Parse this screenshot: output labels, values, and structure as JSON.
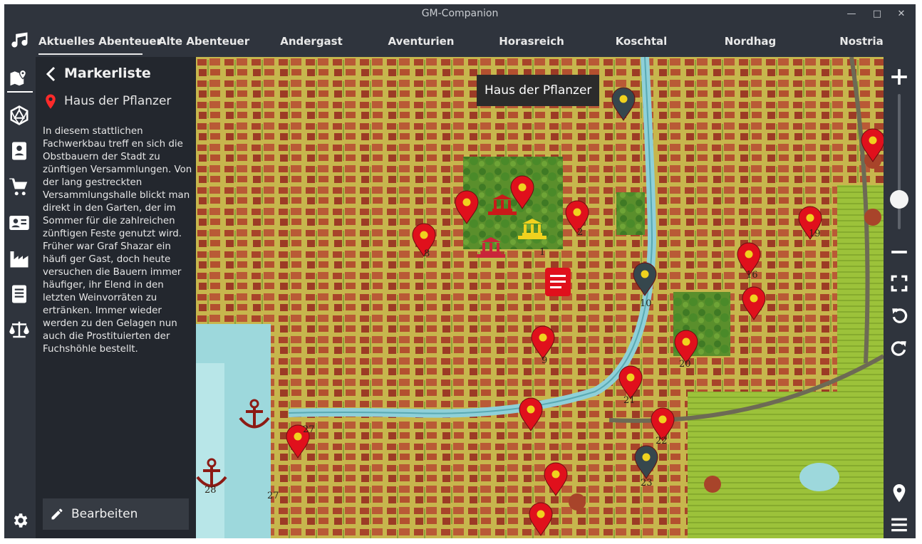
{
  "window": {
    "title": "GM-Companion"
  },
  "tabs": [
    {
      "label": "Aktuelles Abenteuer",
      "active": true
    },
    {
      "label": "Alte Abenteuer",
      "active": false
    },
    {
      "label": "Andergast",
      "active": false
    },
    {
      "label": "Aventurien",
      "active": false
    },
    {
      "label": "Horasreich",
      "active": false
    },
    {
      "label": "Koschtal",
      "active": false
    },
    {
      "label": "Nordhag",
      "active": false
    },
    {
      "label": "Nostria",
      "active": false
    }
  ],
  "left_tools": [
    "music-icon",
    "map-icon",
    "dice-icon",
    "character-icon",
    "shop-icon",
    "contact-card-icon",
    "factory-icon",
    "book-icon",
    "balance-scale-icon",
    "settings-icon"
  ],
  "marker_panel": {
    "title": "Markerliste",
    "marker_name": "Haus der Pflanzer",
    "description": "In diesem stattlichen Fachwerkbau treff en sich die Obstbauern der Stadt zu zünftigen Versammlungen. Von der lang gestreckten Versammlungshalle blickt man direkt in den Garten, der im Sommer für die zahlreichen zünftigen Feste genutzt wird. Früher war Graf Shazar ein häufi ger Gast, doch heute versuchen die Bauern immer häufiger, ihr Elend in den letzten Weinvorräten zu ertränken. Immer wieder werden zu den Gelagen nun auch die Prostituierten der Fuchshöhle bestellt.",
    "edit_label": "Bearbeiten"
  },
  "map": {
    "tooltip": "Haus der Pflanzer",
    "labels": [
      "8",
      "2",
      "19",
      "16",
      "10",
      "9",
      "20",
      "21",
      "22",
      "23",
      "27",
      "27",
      "28",
      "1"
    ],
    "zoom_level": 0.25
  },
  "map_controls": [
    "zoom-in-icon",
    "zoom-out-icon",
    "fit-screen-icon",
    "rotate-left-icon",
    "rotate-right-icon",
    "add-marker-icon",
    "menu-icon"
  ],
  "colors": {
    "marker_red": "#e0101c",
    "marker_dark": "#36474d",
    "building_gold": "#f0d21e",
    "building_red": "#c91a1a",
    "anchor": "#8c1a14",
    "water": "#8fd0d8"
  }
}
